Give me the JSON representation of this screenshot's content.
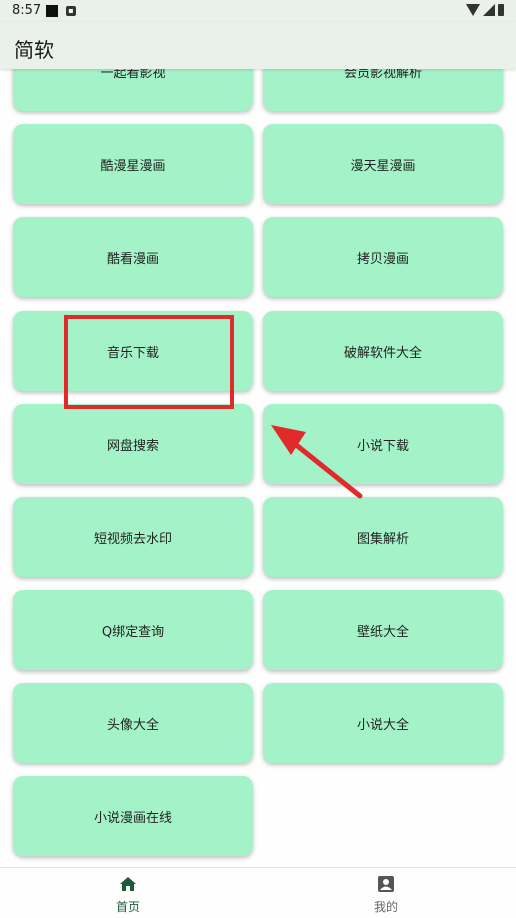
{
  "status_bar": {
    "time": "8:57"
  },
  "app_bar": {
    "title": "简软"
  },
  "cards": [
    "一起看影视",
    "会员影视解析",
    "酷漫星漫画",
    "漫天星漫画",
    "酷看漫画",
    "拷贝漫画",
    "音乐下载",
    "破解软件大全",
    "网盘搜索",
    "小说下载",
    "短视频去水印",
    "图集解析",
    "Q绑定查询",
    "壁纸大全",
    "头像大全",
    "小说大全",
    "小说漫画在线"
  ],
  "bottom_nav": {
    "home": "首页",
    "me": "我的"
  },
  "colors": {
    "card": "#a4f3c8",
    "annotation": "#e02b2b",
    "nav_active": "#1e5b3a"
  }
}
